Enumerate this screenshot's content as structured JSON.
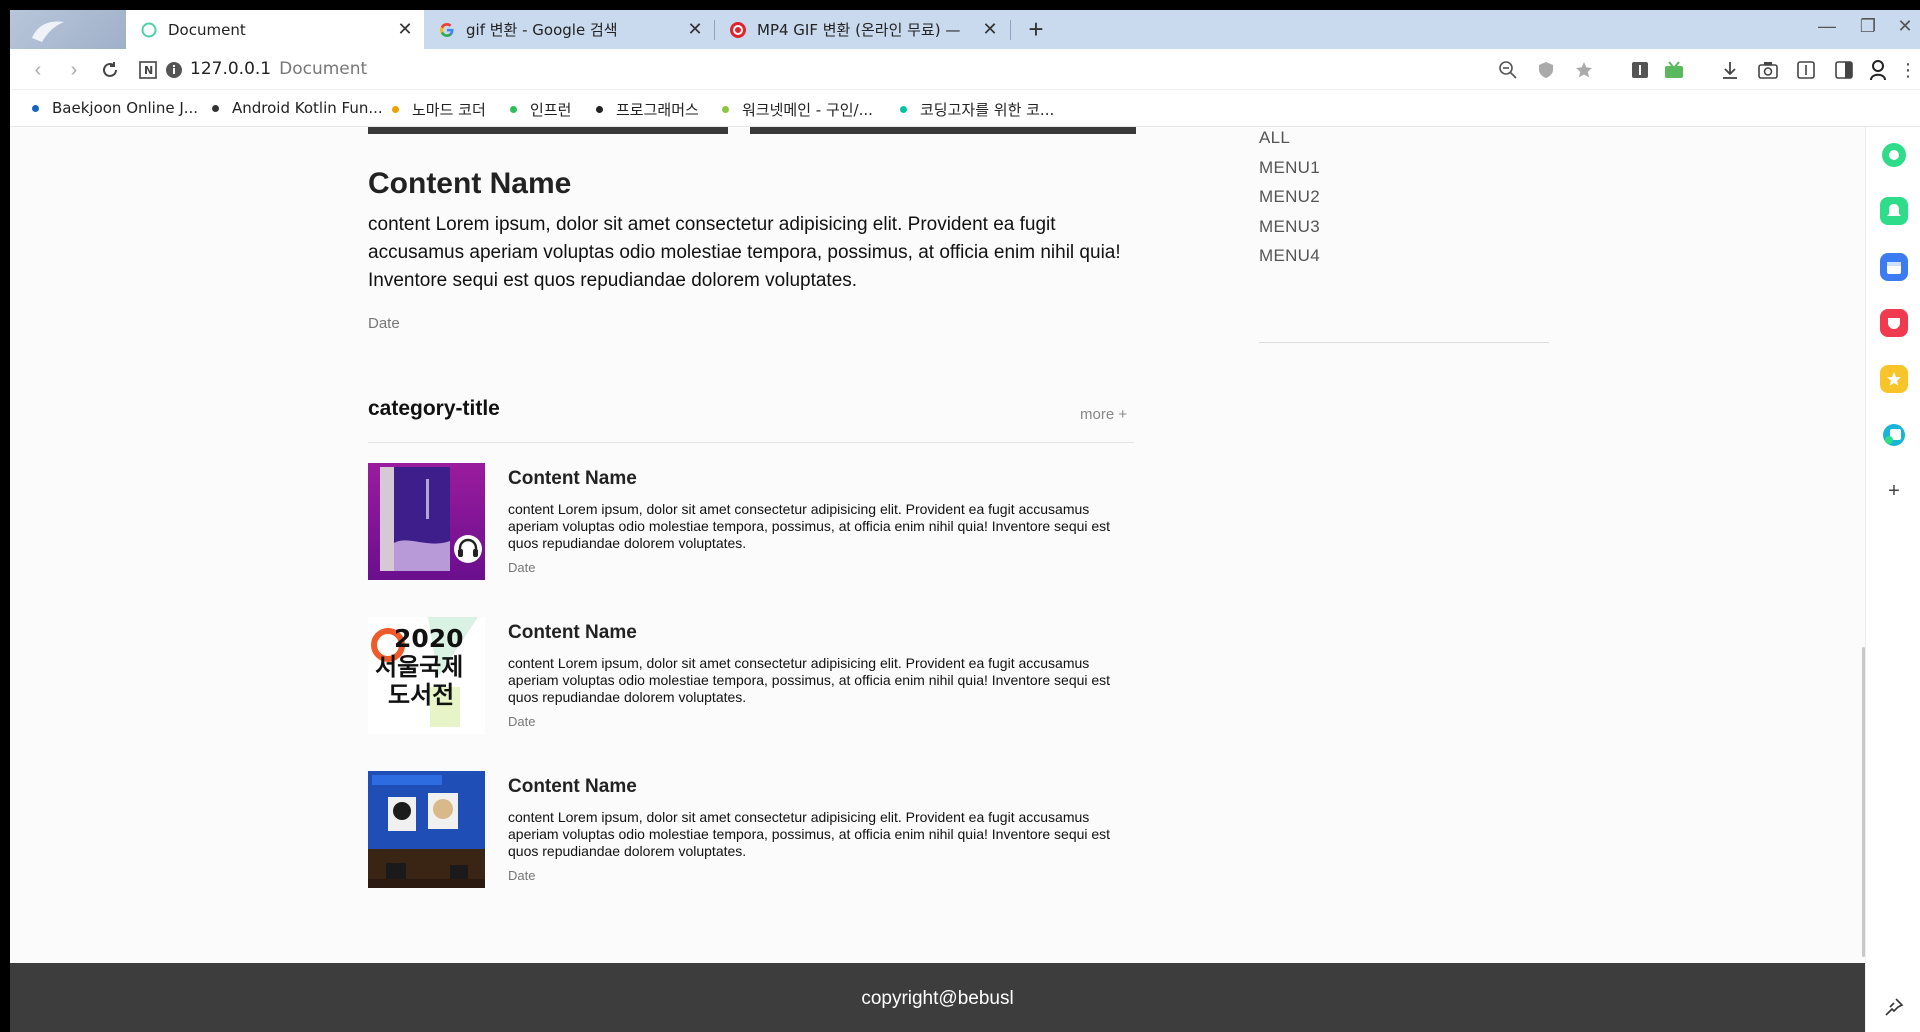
{
  "browser": {
    "tabs": [
      {
        "title": "Document",
        "active": true,
        "icon": "loading-circle-icon"
      },
      {
        "title": "gif 변환 - Google 검색",
        "active": false,
        "icon": "google-icon"
      },
      {
        "title": "MP4 GIF 변환 (온라인 무료) —",
        "active": false,
        "icon": "converter-icon"
      }
    ],
    "new_tab": "+",
    "address": {
      "host": "127.0.0.1",
      "page_title": "Document"
    },
    "bookmarks": [
      {
        "label": "Baekjoon Online J...",
        "color": "#1565c0"
      },
      {
        "label": "Android Kotlin Fun...",
        "color": "#333333"
      },
      {
        "label": "노마드 코더",
        "color": "#f0a000"
      },
      {
        "label": "인프런",
        "color": "#2ebd59"
      },
      {
        "label": "프로그래머스",
        "color": "#222222"
      },
      {
        "label": "워크넷메인 - 구인/...",
        "color": "#8cc63f"
      },
      {
        "label": "코딩고자를 위한 코...",
        "color": "#00c4a0"
      }
    ]
  },
  "main_post": {
    "title": "Content Name",
    "text": "content Lorem ipsum, dolor sit amet consectetur adipisicing elit. Provident ea fugit accusamus aperiam voluptas odio molestiae tempora, possimus, at officia enim nihil quia! Inventore sequi est quos repudiandae dolorem voluptates.",
    "date": "Date"
  },
  "menu": [
    "ALL",
    "MENU1",
    "MENU2",
    "MENU3",
    "MENU4"
  ],
  "category": {
    "title": "category-title",
    "more": "more +",
    "items": [
      {
        "name": "Content Name",
        "text": "content Lorem ipsum, dolor sit amet consectetur adipisicing elit. Provident ea fugit accusamus aperiam voluptas odio molestiae tempora, possimus, at officia enim nihil quia! Inventore sequi est quos repudiandae dolorem voluptates.",
        "date": "Date"
      },
      {
        "name": "Content Name",
        "text": "content Lorem ipsum, dolor sit amet consectetur adipisicing elit. Provident ea fugit accusamus aperiam voluptas odio molestiae tempora, possimus, at officia enim nihil quia! Inventore sequi est quos repudiandae dolorem voluptates.",
        "date": "Date",
        "thumb_text": [
          "2020",
          "서울국제",
          "도서전"
        ]
      },
      {
        "name": "Content Name",
        "text": "content Lorem ipsum, dolor sit amet consectetur adipisicing elit. Provident ea fugit accusamus aperiam voluptas odio molestiae tempora, possimus, at officia enim nihil quia! Inventore sequi est quos repudiandae dolorem voluptates.",
        "date": "Date"
      }
    ]
  },
  "footer": {
    "copyright": "copyright@bebusl"
  }
}
